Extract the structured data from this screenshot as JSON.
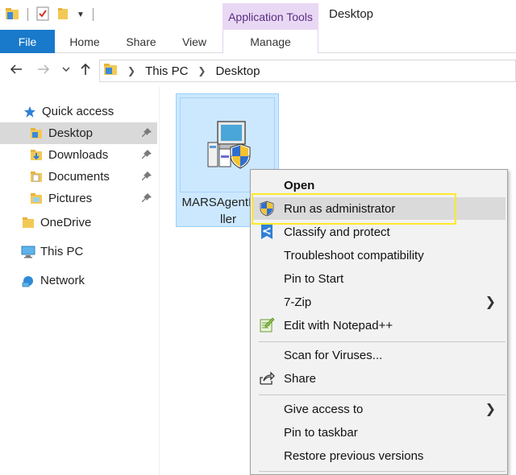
{
  "window": {
    "title": "Desktop",
    "contextual_tab_group": "Application Tools"
  },
  "ribbon": {
    "tabs": [
      {
        "label": "File"
      },
      {
        "label": "Home"
      },
      {
        "label": "Share"
      },
      {
        "label": "View"
      },
      {
        "label": "Manage"
      }
    ]
  },
  "address": {
    "crumbs": [
      "This PC",
      "Desktop"
    ]
  },
  "navpane": {
    "items": [
      {
        "label": "Quick access",
        "icon": "star-icon"
      },
      {
        "label": "Desktop",
        "icon": "desktop-folder-icon",
        "selected": true,
        "pinned": true
      },
      {
        "label": "Downloads",
        "icon": "downloads-folder-icon",
        "pinned": true
      },
      {
        "label": "Documents",
        "icon": "documents-folder-icon",
        "pinned": true
      },
      {
        "label": "Pictures",
        "icon": "pictures-folder-icon",
        "pinned": true
      },
      {
        "label": "OneDrive",
        "icon": "onedrive-folder-icon"
      },
      {
        "label": "This PC",
        "icon": "computer-icon"
      },
      {
        "label": "Network",
        "icon": "network-icon"
      }
    ]
  },
  "file": {
    "name": "MARSAgentInsta\nller",
    "icon": "installer-shield-icon"
  },
  "context_menu": {
    "items": [
      {
        "label": "Open",
        "bold": true
      },
      {
        "label": "Run as administrator",
        "icon": "uac-shield-icon",
        "hovered": true
      },
      {
        "label": "Classify and protect",
        "icon": "classify-icon"
      },
      {
        "label": "Troubleshoot compatibility"
      },
      {
        "label": "Pin to Start"
      },
      {
        "label": "7-Zip",
        "submenu": true
      },
      {
        "label": "Edit with Notepad++",
        "icon": "notepadpp-icon"
      },
      {
        "label": "Scan for Viruses..."
      },
      {
        "label": "Share",
        "icon": "share-icon"
      },
      {
        "label": "Give access to",
        "submenu": true
      },
      {
        "label": "Pin to taskbar"
      },
      {
        "label": "Restore previous versions"
      }
    ]
  },
  "colors": {
    "accent": "#1979ca",
    "highlight": "#ffe92a",
    "selection": "#cce8ff",
    "tools_tab": "#e9d8f4"
  }
}
